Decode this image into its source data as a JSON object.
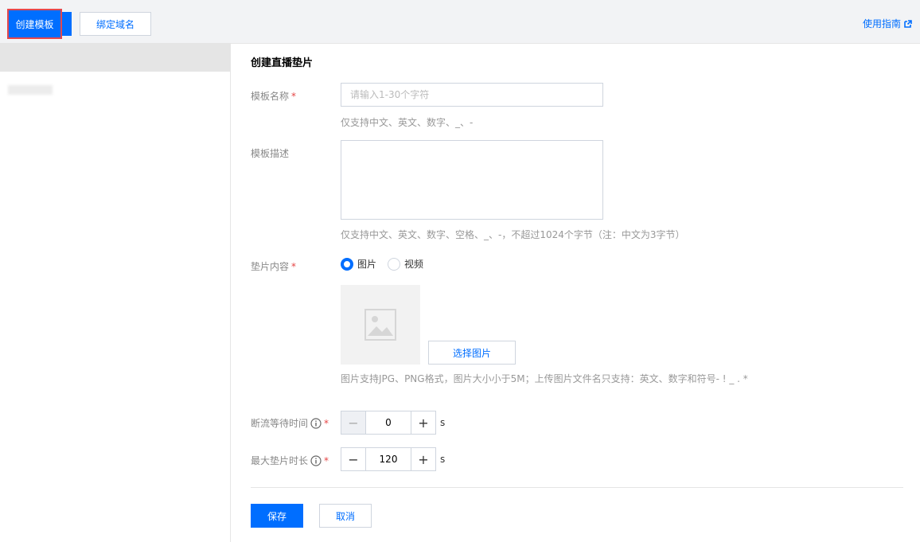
{
  "topbar": {
    "create_template_label": "创建模板",
    "bind_domain_label": "绑定域名",
    "guide_label": "使用指南"
  },
  "form": {
    "title": "创建直播垫片",
    "template_name": {
      "label": "模板名称",
      "placeholder": "请输入1-30个字符",
      "value": "",
      "hint": "仅支持中文、英文、数字、_、-"
    },
    "template_desc": {
      "label": "模板描述",
      "value": "",
      "hint": "仅支持中文、英文、数字、空格、_、-，不超过1024个字节（注：中文为3字节）"
    },
    "slate_content": {
      "label": "垫片内容",
      "options": [
        "图片",
        "视频"
      ],
      "selected": "图片",
      "select_image_label": "选择图片",
      "hint": "图片支持JPG、PNG格式，图片大小小于5M；上传图片文件名只支持：英文、数字和符号- ! _ . *"
    },
    "interrupt_wait": {
      "label": "断流等待时间",
      "value": "0",
      "unit": "s"
    },
    "max_duration": {
      "label": "最大垫片时长",
      "value": "120",
      "unit": "s"
    },
    "save_label": "保存",
    "cancel_label": "取消"
  },
  "colors": {
    "primary": "#006eff",
    "required": "#e54545",
    "highlight_outline": "#e5484d"
  },
  "icons": {
    "guide": "external-link-icon",
    "info": "info-circle-icon",
    "image_placeholder": "image-icon",
    "minus": "minus-icon",
    "plus": "plus-icon"
  }
}
